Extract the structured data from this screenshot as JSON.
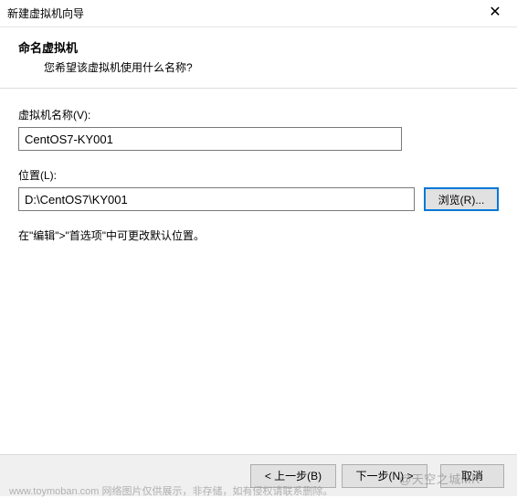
{
  "titlebar": {
    "title": "新建虚拟机向导",
    "close": "✕"
  },
  "header": {
    "title": "命名虚拟机",
    "subtitle": "您希望该虚拟机使用什么名称?"
  },
  "form": {
    "name_label": "虚拟机名称(V):",
    "name_value": "CentOS7-KY001",
    "location_label": "位置(L):",
    "location_value": "D:\\CentOS7\\KY001",
    "browse_label": "浏览(R)...",
    "hint": "在\"编辑\">\"首选项\"中可更改默认位置。"
  },
  "footer": {
    "back": "< 上一步(B)",
    "next": "下一步(N) >",
    "cancel": "取消"
  },
  "watermark": {
    "right": "@天空之城MR",
    "left": "www.toymoban.com 网络图片仅供展示，非存储，如有侵权请联系删除。"
  }
}
